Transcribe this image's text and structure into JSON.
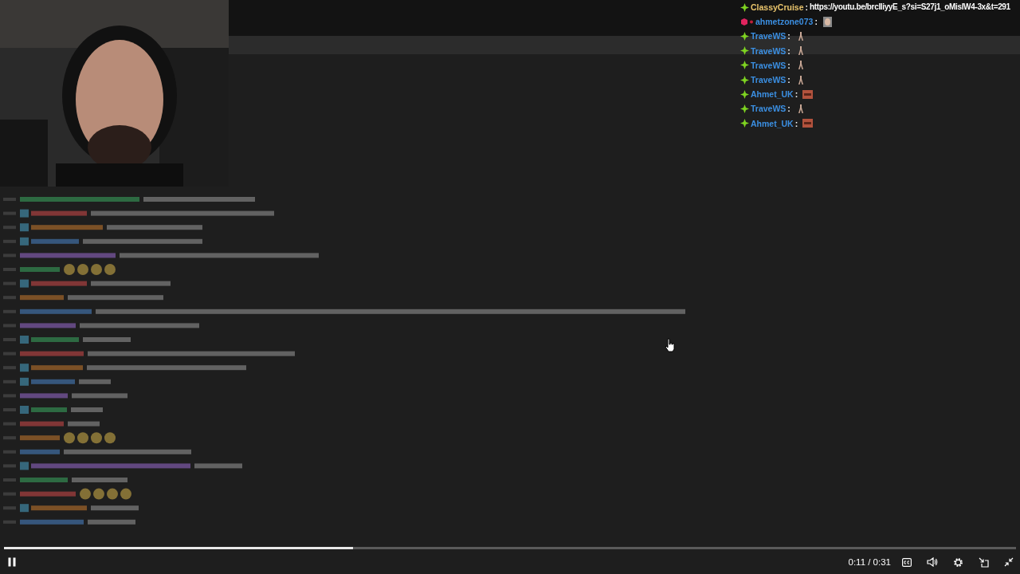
{
  "overlay_chat": [
    {
      "kind": "link",
      "user": "ClassyCruise",
      "color": "#e9c46c",
      "sep": ":",
      "text": "https://youtu.be/brclIiyyE_s?si=S27j1_oMislW4-3x&t=291"
    },
    {
      "kind": "portrait",
      "user": "ahmetzone073",
      "color": "#3b8fe2",
      "sep": ":"
    },
    {
      "kind": "figure",
      "user": "TraveWS",
      "color": "#3b8fe2",
      "sep": ":"
    },
    {
      "kind": "figure",
      "user": "TraveWS",
      "color": "#3b8fe2",
      "sep": ":"
    },
    {
      "kind": "figure",
      "user": "TraveWS",
      "color": "#3b8fe2",
      "sep": ":"
    },
    {
      "kind": "figure",
      "user": "TraveWS",
      "color": "#3b8fe2",
      "sep": ":"
    },
    {
      "kind": "brick",
      "user": "Ahmet_UK",
      "color": "#3b8fe2",
      "sep": ":"
    },
    {
      "kind": "figure",
      "user": "TraveWS",
      "color": "#3b8fe2",
      "sep": ":"
    },
    {
      "kind": "brick",
      "user": "Ahmet_UK",
      "color": "#3b8fe2",
      "sep": ":"
    }
  ],
  "player": {
    "playing": true,
    "progress": {
      "level": 0.345
    },
    "time": "0:11 / 0:31"
  }
}
